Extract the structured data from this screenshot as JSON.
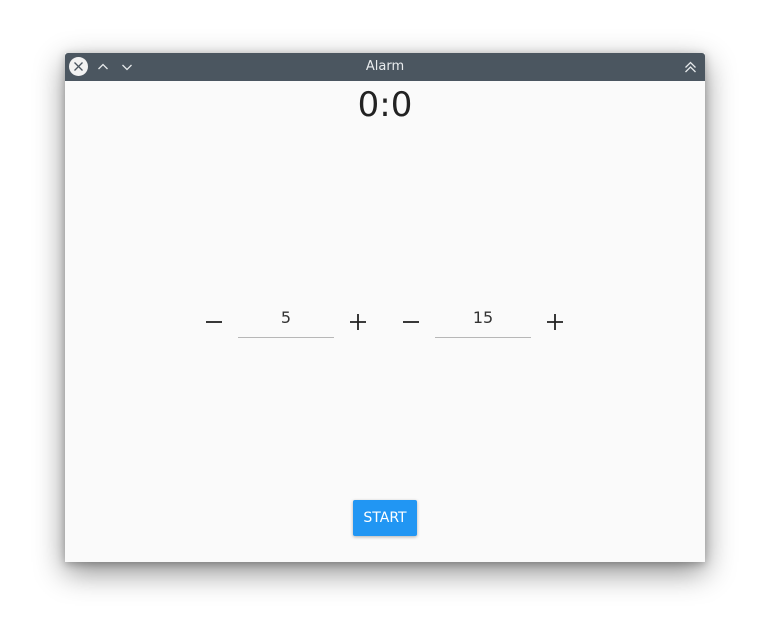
{
  "window": {
    "title": "Alarm"
  },
  "clock": {
    "display": "0:0"
  },
  "hours": {
    "value": "5",
    "decrement_icon": "minus-icon",
    "increment_icon": "plus-icon"
  },
  "minutes": {
    "value": "15",
    "decrement_icon": "minus-icon",
    "increment_icon": "plus-icon"
  },
  "actions": {
    "start_label": "START"
  },
  "colors": {
    "titlebar": "#4b5660",
    "accent": "#2196f3",
    "background": "#fafafa"
  }
}
